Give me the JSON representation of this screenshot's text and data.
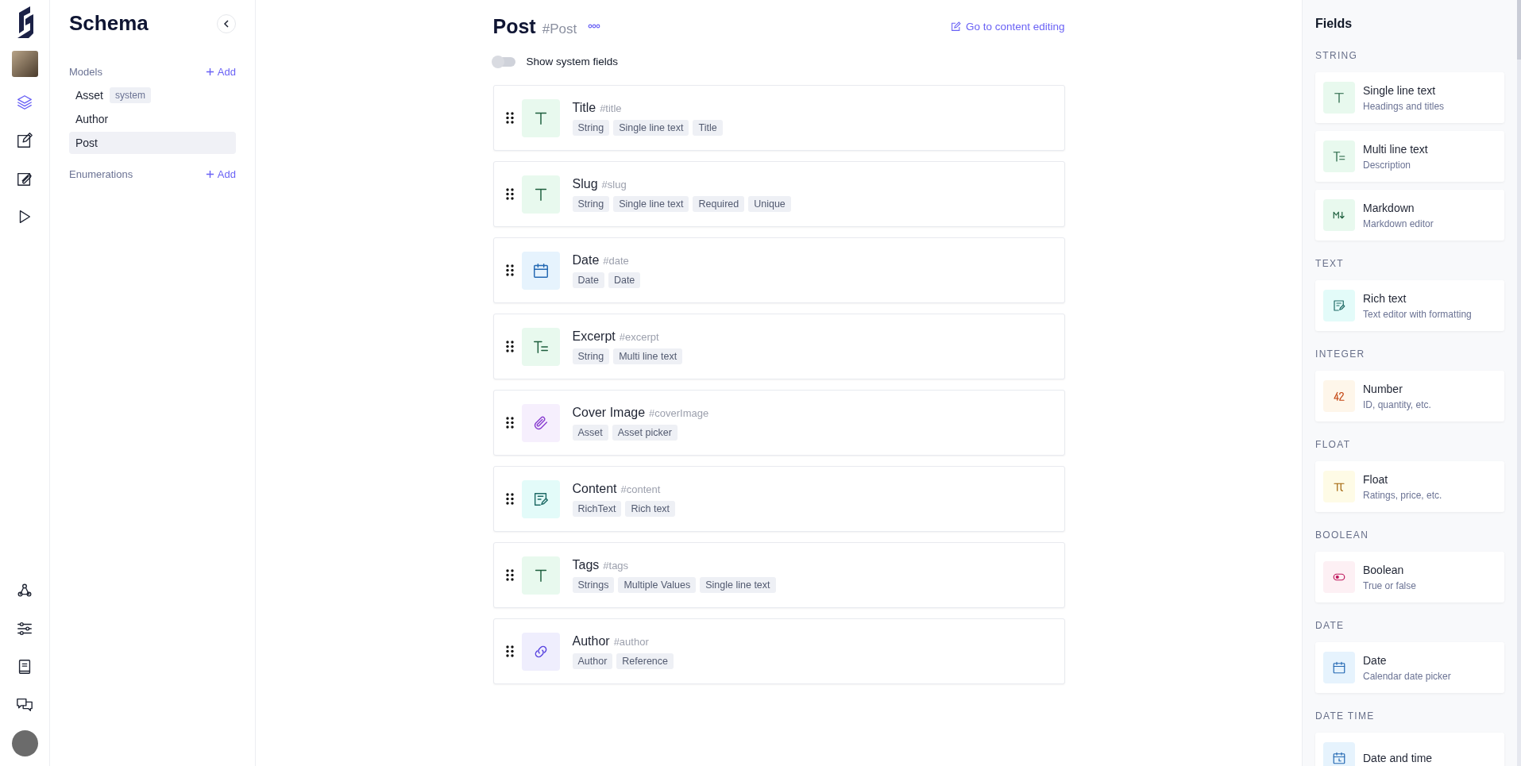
{
  "rail": {
    "top": [
      {
        "kind": "logo"
      },
      {
        "kind": "project-photo"
      },
      {
        "kind": "layers",
        "selected": true
      },
      {
        "kind": "edit",
        "selected": false
      },
      {
        "kind": "edit-clip",
        "selected": false
      },
      {
        "kind": "play",
        "selected": false
      }
    ],
    "bottom": [
      {
        "kind": "webhook",
        "selected": false
      },
      {
        "kind": "sliders",
        "selected": false
      },
      {
        "kind": "book",
        "selected": false
      },
      {
        "kind": "chat",
        "selected": false
      },
      {
        "kind": "avatar"
      }
    ]
  },
  "sidebar": {
    "title": "Schema",
    "sections": [
      {
        "label": "Models",
        "add": "Add",
        "items": [
          {
            "name": "Asset",
            "badge": "system",
            "selected": false
          },
          {
            "name": "Author",
            "selected": false
          },
          {
            "name": "Post",
            "selected": true
          }
        ]
      },
      {
        "label": "Enumerations",
        "add": "Add"
      }
    ]
  },
  "header": {
    "title": "Post",
    "api_id": "#Post",
    "link": "Go to content editing"
  },
  "system_toggle": {
    "label": "Show system fields",
    "on": false
  },
  "fields": [
    {
      "name": "Title",
      "api_id": "#title",
      "kind": "string",
      "tags": [
        "String",
        "Single line text",
        "Title"
      ]
    },
    {
      "name": "Slug",
      "api_id": "#slug",
      "kind": "string",
      "tags": [
        "String",
        "Single line text",
        "Required",
        "Unique"
      ]
    },
    {
      "name": "Date",
      "api_id": "#date",
      "kind": "date",
      "tags": [
        "Date",
        "Date"
      ]
    },
    {
      "name": "Excerpt",
      "api_id": "#excerpt",
      "kind": "multiline",
      "tags": [
        "String",
        "Multi line text"
      ]
    },
    {
      "name": "Cover Image",
      "api_id": "#coverImage",
      "kind": "asset",
      "tags": [
        "Asset",
        "Asset picker"
      ]
    },
    {
      "name": "Content",
      "api_id": "#content",
      "kind": "richtext",
      "tags": [
        "RichText",
        "Rich text"
      ]
    },
    {
      "name": "Tags",
      "api_id": "#tags",
      "kind": "string",
      "tags": [
        "Strings",
        "Multiple Values",
        "Single line text"
      ]
    },
    {
      "name": "Author",
      "api_id": "#author",
      "kind": "reference",
      "tags": [
        "Author",
        "Reference"
      ]
    }
  ],
  "fields_panel": {
    "title": "Fields",
    "groups": [
      {
        "label": "STRING",
        "items": [
          {
            "name": "Single line text",
            "description": "Headings and titles",
            "kind": "string"
          },
          {
            "name": "Multi line text",
            "description": "Description",
            "kind": "multiline"
          },
          {
            "name": "Markdown",
            "description": "Markdown editor",
            "kind": "markdown"
          }
        ]
      },
      {
        "label": "TEXT",
        "items": [
          {
            "name": "Rich text",
            "description": "Text editor with formatting",
            "kind": "richtext"
          }
        ]
      },
      {
        "label": "INTEGER",
        "items": [
          {
            "name": "Number",
            "description": "ID, quantity, etc.",
            "kind": "number"
          }
        ]
      },
      {
        "label": "FLOAT",
        "items": [
          {
            "name": "Float",
            "description": "Ratings, price, etc.",
            "kind": "float"
          }
        ]
      },
      {
        "label": "BOOLEAN",
        "items": [
          {
            "name": "Boolean",
            "description": "True or false",
            "kind": "boolean"
          }
        ]
      },
      {
        "label": "DATE",
        "items": [
          {
            "name": "Date",
            "description": "Calendar date picker",
            "kind": "date"
          }
        ]
      },
      {
        "label": "DATE TIME",
        "items": [
          {
            "name": "Date and time",
            "kind": "datetime"
          }
        ]
      }
    ]
  }
}
